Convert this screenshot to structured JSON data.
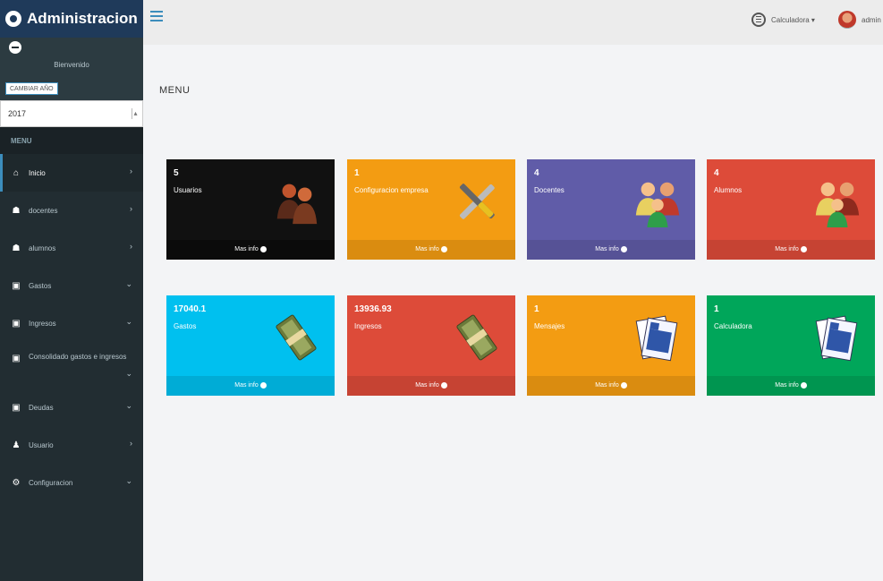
{
  "app": {
    "title": "Administracion"
  },
  "sidebar": {
    "welcome": "Bienvenido",
    "year_button": "CAMBIAR AÑO",
    "year_value": "2017",
    "menu_header": "MENU",
    "items": [
      {
        "label": "Inicio",
        "icon": "dashboard-icon",
        "chevron": "›"
      },
      {
        "label": "docentes",
        "icon": "users-icon",
        "chevron": "›"
      },
      {
        "label": "alumnos",
        "icon": "users-icon",
        "chevron": "›"
      },
      {
        "label": "Gastos",
        "icon": "money-icon",
        "chevron": "⌄"
      },
      {
        "label": "Ingresos",
        "icon": "money-icon",
        "chevron": "⌄"
      },
      {
        "label": "Consolidado gastos e ingresos",
        "icon": "money-icon",
        "chevron": "⌄"
      },
      {
        "label": "Deudas",
        "icon": "money-icon",
        "chevron": "⌄"
      },
      {
        "label": "Usuario",
        "icon": "user-icon",
        "chevron": "›"
      },
      {
        "label": "Configuracion",
        "icon": "gear-icon",
        "chevron": "⌄"
      }
    ]
  },
  "topbar": {
    "calculator_label": "Calculadora ▾",
    "user_label": "admin"
  },
  "content": {
    "title": "MENU",
    "boxes": [
      {
        "number": "5",
        "label": "Usuarios",
        "footer": "Mas info",
        "color": "#111111",
        "icon": "people-icon"
      },
      {
        "number": "1",
        "label": "Configuracion empresa",
        "footer": "Mas info",
        "color": "#f39c12",
        "icon": "tools-icon"
      },
      {
        "number": "4",
        "label": "Docentes",
        "footer": "Mas info",
        "color": "#605ca8",
        "icon": "people-icon"
      },
      {
        "number": "4",
        "label": "Alumnos",
        "footer": "Mas info",
        "color": "#dd4b39",
        "icon": "people-icon"
      },
      {
        "number": "17040.1",
        "label": "Gastos",
        "footer": "Mas info",
        "color": "#00c0ef",
        "icon": "money-stack-icon"
      },
      {
        "number": "13936.93",
        "label": "Ingresos",
        "footer": "Mas info",
        "color": "#dd4b39",
        "icon": "money-stack-icon"
      },
      {
        "number": "1",
        "label": "Mensajes",
        "footer": "Mas info",
        "color": "#f39c12",
        "icon": "document-icon"
      },
      {
        "number": "1",
        "label": "Calculadora",
        "footer": "Mas info",
        "color": "#00a65a",
        "icon": "document-icon"
      }
    ]
  }
}
